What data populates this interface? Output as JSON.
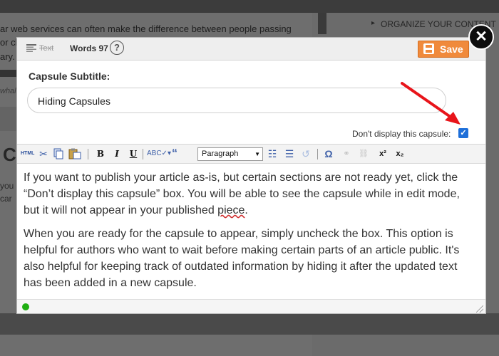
{
  "background": {
    "article_lines": [
      "ar web services can often make the difference between people passing",
      "or cl",
      "ary."
    ],
    "italic_text": "whal",
    "big_letter": "C",
    "body_lines": [
      "you",
      "car"
    ],
    "sidebar_heading": "ORGANIZE YOUR CONTENT"
  },
  "close_button": {
    "icon": "close-icon",
    "glyph": "✕"
  },
  "header": {
    "text_mode_label": "Text",
    "word_count": "Words 97",
    "help_glyph": "?",
    "save_label": "Save",
    "save_color": "#f08a3c"
  },
  "form": {
    "subtitle_label": "Capsule Subtitle:",
    "subtitle_value": "Hiding Capsules",
    "hide_checkbox_label": "Don't display this capsule:",
    "hide_checkbox_checked": true,
    "checkbox_color": "#1e6fd9",
    "annotation_arrow_color": "#e8141a"
  },
  "toolbar": {
    "html_label": "HTML",
    "bold": "B",
    "italic": "I",
    "underline": "U",
    "format_select_value": "Paragraph",
    "superscript": "x²",
    "subscript": "x₂",
    "omega": "Ω"
  },
  "content": {
    "paragraph1_part1": "If you want to publish your article as-is, but certain sections are not ready yet, click the “Don’t display this capsule” box. You will be able to see the capsule while in edit mode, but it will not appear in your published ",
    "paragraph1_misspelled": "piece",
    "paragraph1_end": ".",
    "paragraph2": "When you are ready for the capsule to appear, simply uncheck the box. This option is helpful for authors who want to wait before making certain parts of an article public. It's also helpful for keeping track of outdated information by hiding it after the updated text has been added in a new capsule."
  },
  "status": {
    "indicator_color": "#1fae12"
  }
}
